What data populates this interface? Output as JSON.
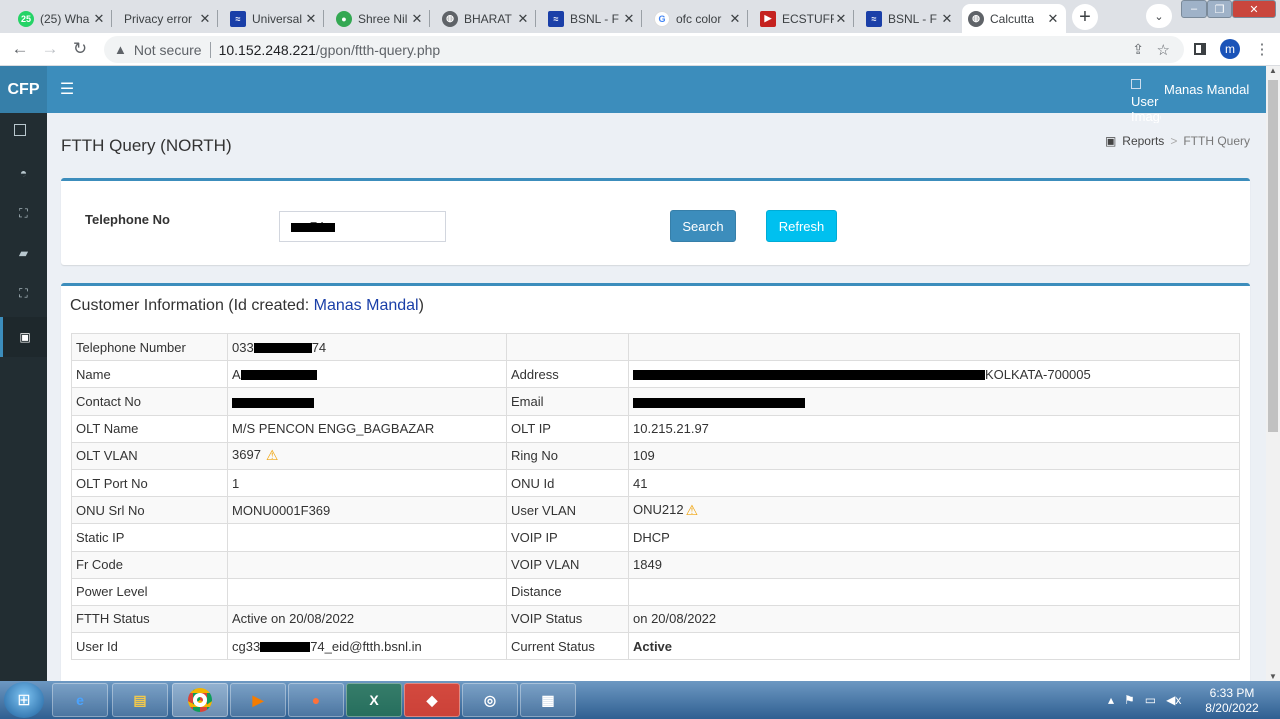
{
  "browser": {
    "tabs": [
      {
        "title": "(25) Wha",
        "favicon": "whatsapp-icon",
        "color": "#25d366"
      },
      {
        "title": "Privacy error",
        "favicon": "warning-icon",
        "color": "#d93025"
      },
      {
        "title": "Universal",
        "favicon": "bsnl-icon",
        "color": "#1a3fa8"
      },
      {
        "title": "Shree Nil",
        "favicon": "maps-pin-icon",
        "color": "#34a853"
      },
      {
        "title": "BHARAT",
        "favicon": "globe-icon",
        "color": "#5f6368"
      },
      {
        "title": "BSNL - F",
        "favicon": "bsnl-icon",
        "color": "#1a3fa8"
      },
      {
        "title": "ofc color",
        "favicon": "google-icon",
        "color": "#4285f4"
      },
      {
        "title": "ECSTUFF",
        "favicon": "ecstuff-icon",
        "color": "#c5221f"
      },
      {
        "title": "BSNL - F",
        "favicon": "bsnl-icon",
        "color": "#1a3fa8"
      },
      {
        "title": "Calcutta",
        "favicon": "globe-icon",
        "color": "#5f6368"
      }
    ],
    "close_glyph": "✕",
    "new_tab_glyph": "+",
    "security_label": "Not secure",
    "url_host": "10.152.248.221",
    "url_path": "/gpon/ftth-query.php",
    "profile_initial": "m"
  },
  "app": {
    "logo": "CFP",
    "user_image_alt": "User Image",
    "user_name": "Manas Mandal",
    "page_title": "FTTH Query  (NORTH)",
    "breadcrumb": {
      "reports": "Reports",
      "separator": ">",
      "current": "FTTH Query"
    },
    "search": {
      "label": "Telephone No",
      "value": "74",
      "search_button": "Search",
      "refresh_button": "Refresh"
    },
    "info": {
      "title_prefix": "Customer Information (Id created: ",
      "creator": "Manas Mandal",
      "title_suffix": ")",
      "rows": [
        {
          "l1": "Telephone Number",
          "v1a": "033",
          "v1b": "74",
          "l2": "",
          "v2": ""
        },
        {
          "l1": "Name",
          "v1a": "A",
          "v1b": "",
          "l2": "Address",
          "v2": "KOLKATA-700005"
        },
        {
          "l1": "Contact No",
          "v1a": "",
          "v1b": "",
          "l2": "Email",
          "v2": ""
        },
        {
          "l1": "OLT Name",
          "v1a": "M/S PENCON ENGG_BAGBAZAR",
          "v1b": "",
          "l2": "OLT IP",
          "v2": "10.215.21.97"
        },
        {
          "l1": "OLT VLAN",
          "v1a": "3697",
          "v1b": "",
          "l2": "Ring No",
          "v2": "109"
        },
        {
          "l1": "OLT Port No",
          "v1a": "1",
          "v1b": "",
          "l2": "ONU Id",
          "v2": "41"
        },
        {
          "l1": "ONU Srl No",
          "v1a": "MONU0001F369",
          "v1b": "",
          "l2": "User VLAN",
          "v2": "ONU212"
        },
        {
          "l1": "Static IP",
          "v1a": "",
          "v1b": "",
          "l2": "VOIP IP",
          "v2": "DHCP"
        },
        {
          "l1": "Fr Code",
          "v1a": "",
          "v1b": "",
          "l2": "VOIP VLAN",
          "v2": "1849"
        },
        {
          "l1": "Power Level",
          "v1a": "",
          "v1b": "",
          "l2": "Distance",
          "v2": ""
        },
        {
          "l1": "FTTH Status",
          "v1a": "Active on 20/08/2022",
          "v1b": "",
          "l2": "VOIP Status",
          "v2": "on 20/08/2022"
        },
        {
          "l1": "User Id",
          "v1a": "cg33",
          "v1b": "74_eid@ftth.bsnl.in",
          "l2": "Current Status",
          "v2": "Active"
        }
      ]
    }
  },
  "taskbar": {
    "time": "6:33 PM",
    "date": "8/20/2022"
  }
}
